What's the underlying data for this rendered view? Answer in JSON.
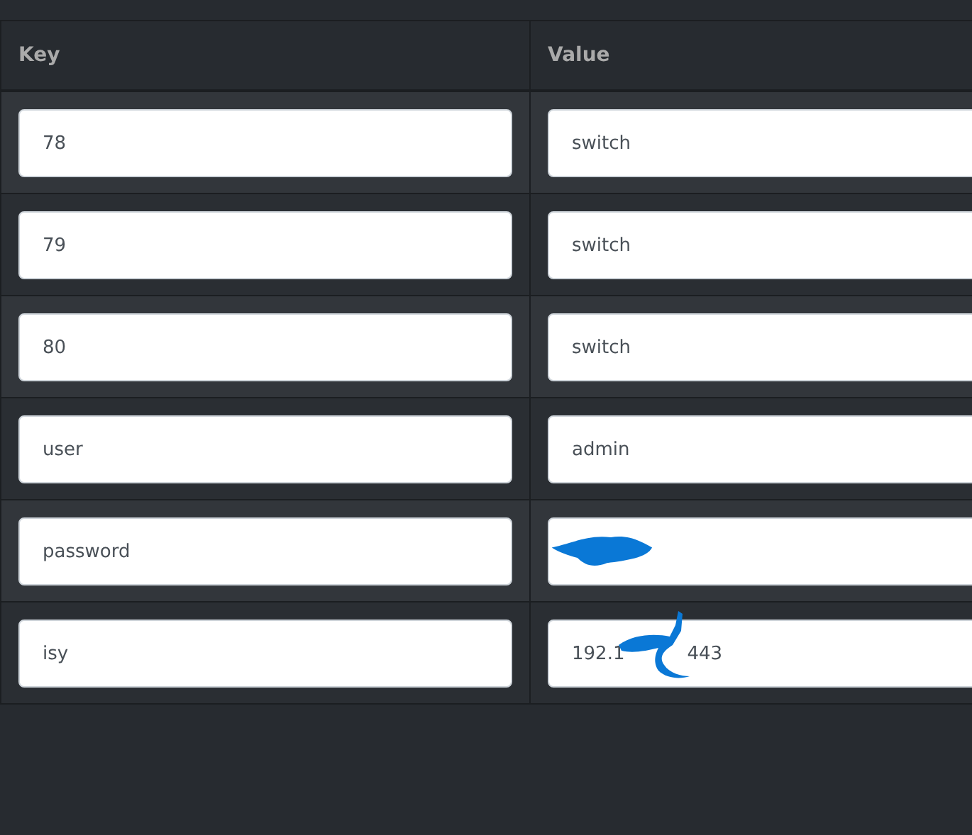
{
  "table": {
    "columns": [
      "Key",
      "Value"
    ],
    "rows": [
      {
        "key": "78",
        "value": "switch",
        "redacted": false
      },
      {
        "key": "79",
        "value": "switch",
        "redacted": false
      },
      {
        "key": "80",
        "value": "switch",
        "redacted": false
      },
      {
        "key": "user",
        "value": "admin",
        "redacted": false
      },
      {
        "key": "password",
        "redacted": true
      },
      {
        "key": "isy",
        "value": "192.1",
        "value_tail": "443",
        "redacted": true
      }
    ]
  }
}
